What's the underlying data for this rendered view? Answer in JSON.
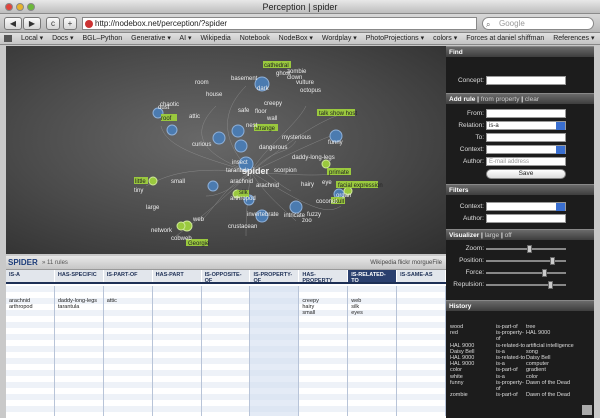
{
  "window": {
    "title": "Perception | spider"
  },
  "toolbar": {
    "back": "◀",
    "forward": "▶",
    "reload": "c",
    "add": "+",
    "url": "http://nodebox.net/perception/?spider",
    "search_placeholder": "Google"
  },
  "bookmarks": [
    "Local ▾",
    "Docs ▾",
    "BGL–Python",
    "Generative ▾",
    "AI ▾",
    "Wikipedia",
    "Notebook",
    "NodeBox ▾",
    "Wordplay ▾",
    "PhotoProjections ▾",
    "colors ▾",
    "Forces at daniel shiffman",
    "References ▾"
  ],
  "graph": {
    "center_label": "spider"
  },
  "sidebar": {
    "find": {
      "heading": "Find",
      "concept_label": "Concept:"
    },
    "add_rule": {
      "heading": "Add rule",
      "from_property": "from property",
      "clear": "clear",
      "from_label": "From:",
      "relation_label": "Relation:",
      "relation_value": "is-a",
      "to_label": "To:",
      "context_label": "Context:",
      "author_label": "Author:",
      "author_placeholder": "E-mail address",
      "save": "Save"
    },
    "filters": {
      "heading": "Filters",
      "context_label": "Context:",
      "author_label": "Author:"
    },
    "visualizer": {
      "heading": "Visualizer",
      "large": "large",
      "off": "off",
      "zoom_label": "Zoom:",
      "position_label": "Position:",
      "force_label": "Force:",
      "repulsion_label": "Repulsion:",
      "zoom": 0.55,
      "position": 0.85,
      "force": 0.75,
      "repulsion": 0.82
    },
    "history": {
      "heading": "History",
      "rows": [
        [
          "wood",
          "is-part-of",
          "tree"
        ],
        [
          "red",
          "is-property-of",
          "HAL 9000"
        ],
        [
          "HAL 9000",
          "is-related-to",
          "artificial intelligence"
        ],
        [
          "Daisy Bell",
          "is-a",
          "song"
        ],
        [
          "HAL 9000",
          "is-related-to",
          "Daisy Bell"
        ],
        [
          "HAL 9000",
          "is-a",
          "computer"
        ],
        [
          "color",
          "is-part-of",
          "gradient"
        ],
        [
          "white",
          "is-a",
          "color"
        ],
        [
          "funny",
          "is-property-of",
          "Dawn of the Dead"
        ],
        [
          "zombie",
          "is-part-of",
          "Dawn of the Dead"
        ]
      ]
    }
  },
  "rules": {
    "title": "SPIDER",
    "count": "» 11 rules",
    "sources": [
      "Wikipedia",
      "flickr",
      "morgueFile"
    ],
    "columns": [
      "IS-A",
      "HAS-SPECIFIC",
      "IS-PART-OF",
      "HAS-PART",
      "IS-OPPOSITE-OF",
      "IS-PROPERTY-OF",
      "HAS-PROPERTY",
      "IS-RELATED-TO",
      "IS-SAME-AS"
    ],
    "cells": [
      [
        "arachnid",
        "arthropod"
      ],
      [
        "daddy-long-legs",
        "tarantula"
      ],
      [
        "attic"
      ],
      [],
      [],
      [],
      [
        "creepy",
        "hairy",
        "small"
      ],
      [
        "web",
        "silk",
        "eyes"
      ],
      []
    ]
  },
  "colors": {
    "node_blue": "#4b7bb0",
    "node_green": "#9ac93e",
    "header_blue": "#1d2f55"
  }
}
